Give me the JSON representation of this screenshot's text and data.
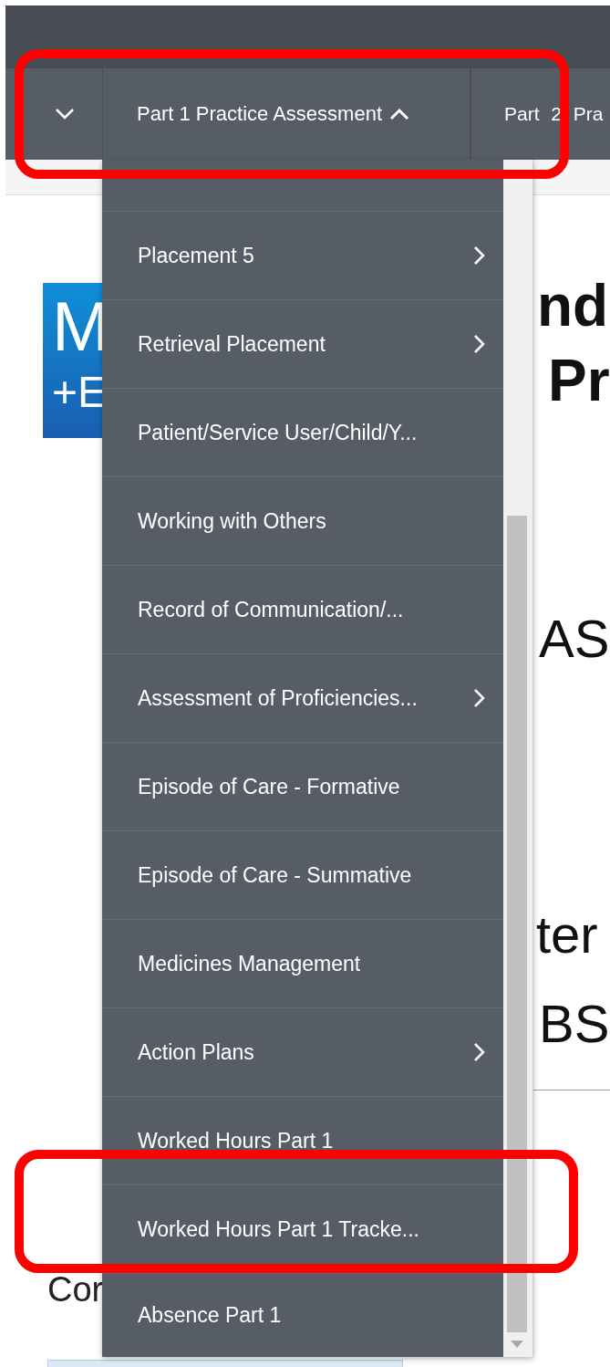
{
  "nav": {
    "tabs": [
      {
        "kind": "toggle",
        "expanded": false
      },
      {
        "kind": "tab",
        "label": "Part 1 Practice Assessment",
        "expanded": true
      },
      {
        "kind": "tab",
        "label": "Part 2 Pra",
        "expanded": false
      }
    ]
  },
  "menu": {
    "items": [
      {
        "label": "Placement 5",
        "has_submenu": true
      },
      {
        "label": "Retrieval Placement",
        "has_submenu": true
      },
      {
        "label": "Patient/Service User/Child/Y...",
        "has_submenu": false
      },
      {
        "label": "Working with Others",
        "has_submenu": false
      },
      {
        "label": "Record of Communication/...",
        "has_submenu": false
      },
      {
        "label": "Assessment of Proficiencies...",
        "has_submenu": true
      },
      {
        "label": "Episode of Care - Formative",
        "has_submenu": false
      },
      {
        "label": "Episode of Care - Summative",
        "has_submenu": false
      },
      {
        "label": "Medicines Management",
        "has_submenu": false
      },
      {
        "label": "Action Plans",
        "has_submenu": true
      },
      {
        "label": "Worked Hours Part 1",
        "has_submenu": false
      },
      {
        "label": "Worked Hours Part 1 Tracke...",
        "has_submenu": false
      },
      {
        "label": "Absence Part 1",
        "has_submenu": false
      }
    ]
  },
  "logo": {
    "line_1": "M",
    "line_2": "+E"
  },
  "background_text": {
    "heading_1": "nd",
    "heading_2": "Pr",
    "line_1": "AS",
    "line_2": "ter",
    "line_3": "BS",
    "left_text": "Cor"
  }
}
